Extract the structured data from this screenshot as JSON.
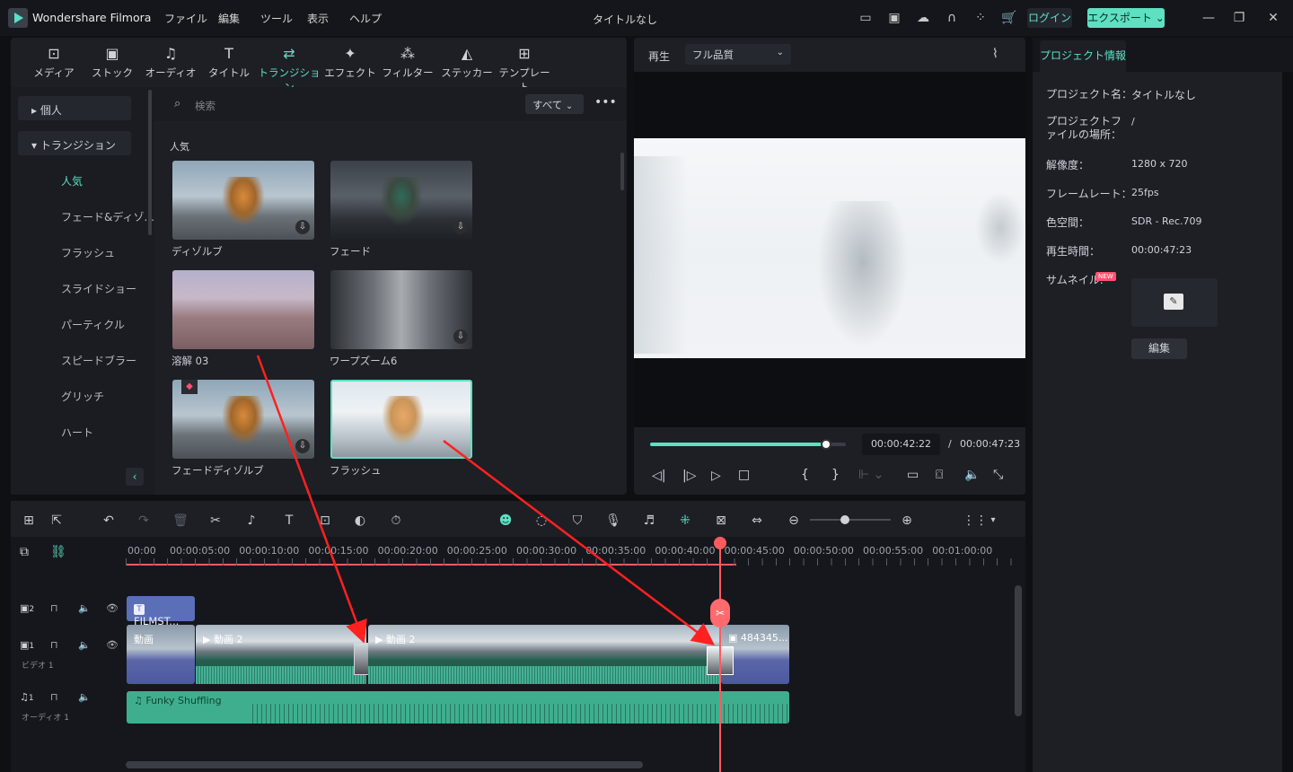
{
  "app": {
    "name": "Wondershare Filmora",
    "title": "タイトルなし",
    "login": "ログイン",
    "export": "エクスポート"
  },
  "menu": [
    "ファイル",
    "編集",
    "ツール",
    "表示",
    "ヘルプ"
  ],
  "tabs": [
    {
      "label": "メディア",
      "icon": "media-icon"
    },
    {
      "label": "ストック",
      "icon": "stock-icon"
    },
    {
      "label": "オーディオ",
      "icon": "music-icon"
    },
    {
      "label": "タイトル",
      "icon": "title-icon"
    },
    {
      "label": "トランジション",
      "icon": "transition-icon"
    },
    {
      "label": "エフェクト",
      "icon": "effect-icon"
    },
    {
      "label": "フィルター",
      "icon": "filter-icon"
    },
    {
      "label": "ステッカー",
      "icon": "sticker-icon"
    },
    {
      "label": "テンプレート",
      "icon": "template-icon"
    }
  ],
  "sidebar": {
    "group1": "個人",
    "group2": "トランジション",
    "items": [
      "人気",
      "フェード&ディゾ...",
      "フラッシュ",
      "スライドショー",
      "パーティクル",
      "スピードブラー",
      "グリッチ",
      "ハート"
    ]
  },
  "search": {
    "placeholder": "検索",
    "filter": "すべて"
  },
  "section": "人気",
  "transitions": [
    "ディゾルブ",
    "フェード",
    "溶解 03",
    "ワープズーム6",
    "フェードディゾルブ",
    "フラッシュ"
  ],
  "player": {
    "label": "再生",
    "quality": "フル品質",
    "current": "00:00:42:22",
    "separator": "/",
    "total": "00:00:47:23",
    "progress": 0.9
  },
  "project": {
    "tab": "プロジェクト情報",
    "rows": [
      {
        "k": "プロジェクト名：",
        "v": "タイトルなし"
      },
      {
        "k": "プロジェクトファイルの場所：",
        "v": "/"
      },
      {
        "k": "解像度：",
        "v": "1280 x 720"
      },
      {
        "k": "フレームレート：",
        "v": "25fps"
      },
      {
        "k": "色空間：",
        "v": "SDR - Rec.709"
      },
      {
        "k": "再生時間：",
        "v": "00:00:47:23"
      }
    ],
    "thumbnail": "サムネイル:",
    "new": "NEW",
    "edit": "編集"
  },
  "ruler": [
    "00:00",
    "00:00:05:00",
    "00:00:10:00",
    "00:00:15:00",
    "00:00:20:00",
    "00:00:25:00",
    "00:00:30:00",
    "00:00:35:00",
    "00:00:40:00",
    "00:00:45:00",
    "00:00:50:00",
    "00:00:55:00",
    "00:01:00:00"
  ],
  "tracks": {
    "t2": "2",
    "t1": "1",
    "video": "ビデオ 1",
    "a1": "1",
    "audio": "オーディオ 1"
  },
  "clips": {
    "title": "FILMST...",
    "v1": "動画",
    "v2": "動画 2",
    "v3": "動画 2",
    "img": "484345...",
    "audio": "Funky Shuffling"
  },
  "colors": {
    "accent": "#5ee0c1",
    "playhead": "#ff5a5f",
    "arrow": "#ff2020"
  }
}
